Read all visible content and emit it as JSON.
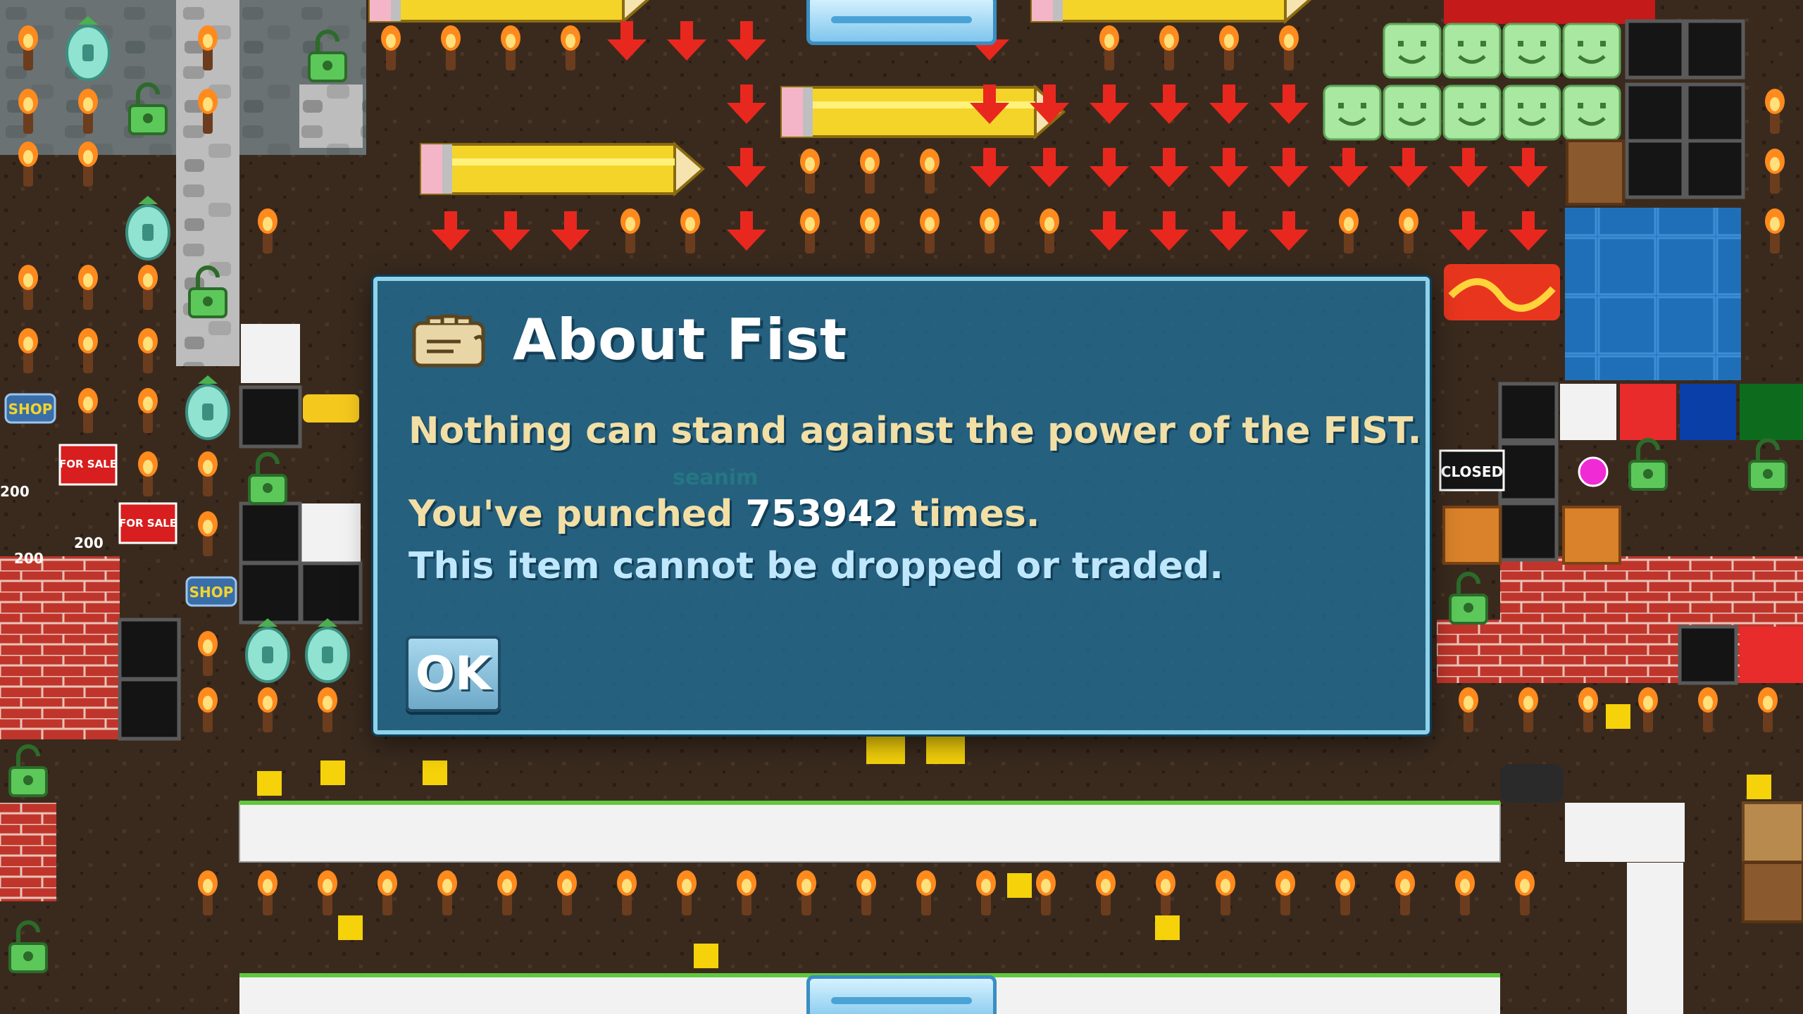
{
  "dialog": {
    "title": "About Fist",
    "flavor_text": "Nothing can stand against the power of the FIST.",
    "punch_prefix": "You've punched ",
    "punch_count": "753942",
    "punch_suffix": " times.",
    "untradeable_text": "This item cannot be dropped or traded.",
    "ok_label": "OK",
    "icon": "fist-icon"
  },
  "world": {
    "shop_sign_1": "SHOP",
    "shop_sign_2": "SHOP",
    "for_sale_1": "FOR SALE",
    "for_sale_2": "FOR SALE",
    "price_tag_1": "200",
    "price_tag_2": "200",
    "price_tag_3": "200",
    "closed_sign": "CLOSED",
    "player_name": "seanim"
  },
  "colors": {
    "dialog_bg": "#206e96",
    "dialog_border": "#8fd3ea",
    "flavor_text": "#f2dfa6",
    "untradeable_text": "#bfe8ff",
    "brick": "#c0352b",
    "arrow": "#e8281e",
    "torch_flame": "#ff8a1e"
  }
}
